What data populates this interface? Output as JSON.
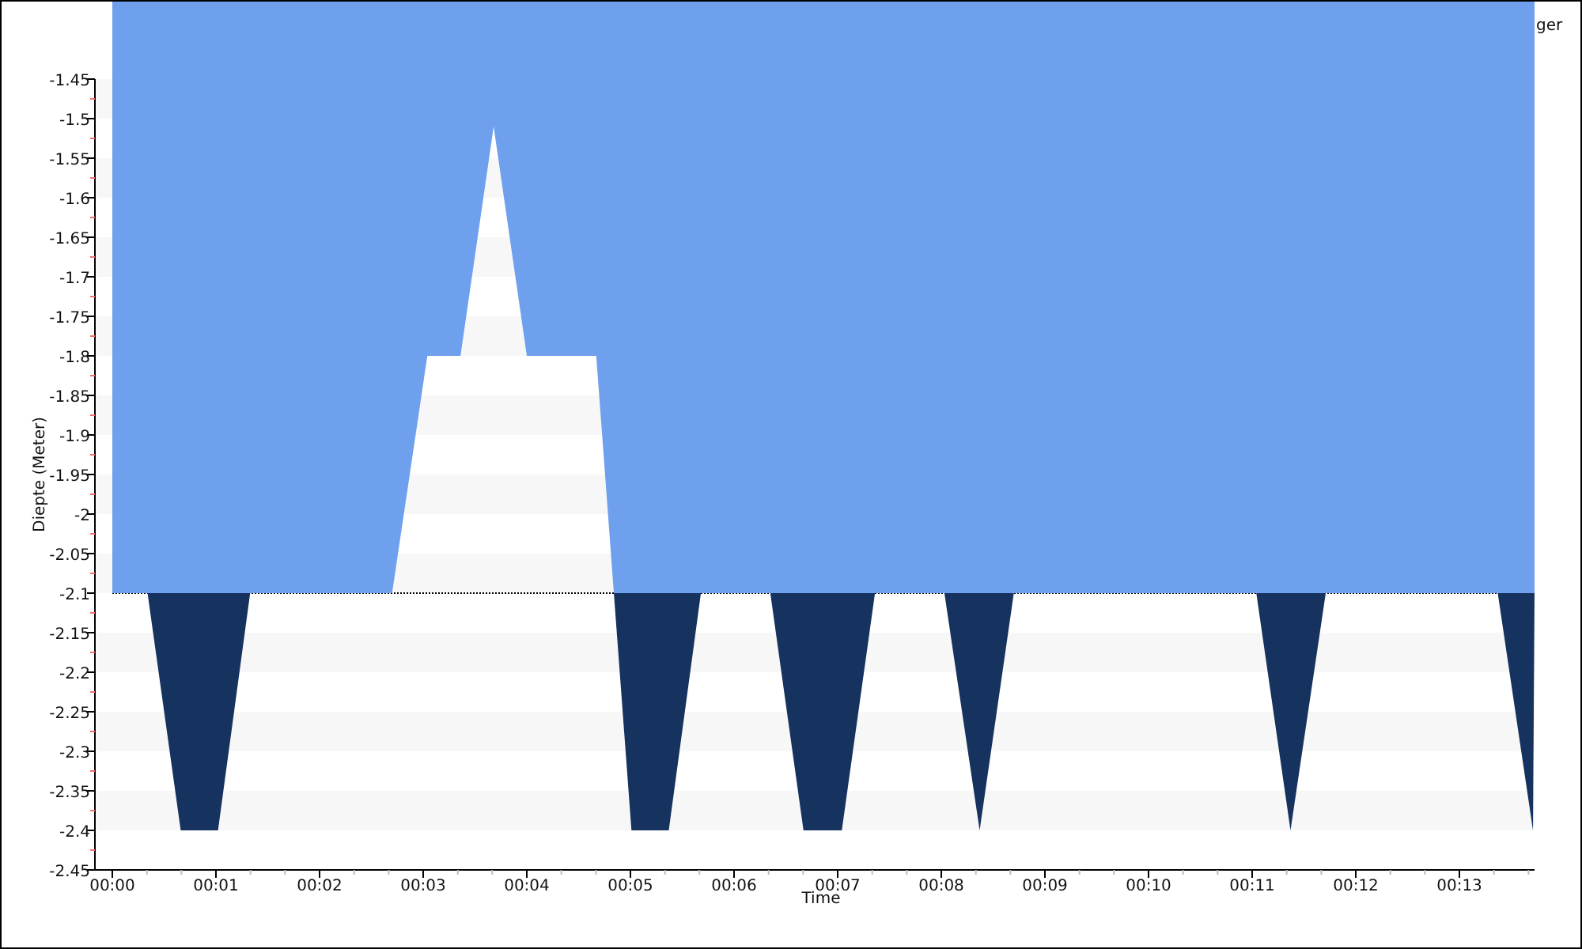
{
  "chart_data": {
    "type": "area",
    "xlabel": "Time",
    "ylabel": "Diepte (Meter)",
    "xlim": [
      -0.168,
      13.725
    ],
    "ylim": [
      -2.45,
      -1.45
    ],
    "xticks": [
      {
        "value": 0,
        "label": "00:00"
      },
      {
        "value": 1,
        "label": "00:01"
      },
      {
        "value": 2,
        "label": "00:02"
      },
      {
        "value": 3,
        "label": "00:03"
      },
      {
        "value": 4,
        "label": "00:04"
      },
      {
        "value": 5,
        "label": "00:05"
      },
      {
        "value": 6,
        "label": "00:06"
      },
      {
        "value": 7,
        "label": "00:07"
      },
      {
        "value": 8,
        "label": "00:08"
      },
      {
        "value": 9,
        "label": "00:09"
      },
      {
        "value": 10,
        "label": "00:10"
      },
      {
        "value": 11,
        "label": "00:11"
      },
      {
        "value": 12,
        "label": "00:12"
      },
      {
        "value": 13,
        "label": "00:13"
      }
    ],
    "yticks": [
      -2.45,
      -2.4,
      -2.35,
      -2.3,
      -2.25,
      -2.2,
      -2.15,
      -2.1,
      -2.05,
      -2,
      -1.95,
      -1.9,
      -1.85,
      -1.8,
      -1.75,
      -1.7,
      -1.65,
      -1.6,
      -1.55,
      -1.5,
      -1.45
    ],
    "x": [
      0,
      0.34,
      0.66,
      1.02,
      1.33,
      2.7,
      3.04,
      3.36,
      3.68,
      4.0,
      4.67,
      4.84,
      5.01,
      5.37,
      5.68,
      6.35,
      6.67,
      7.04,
      7.36,
      8.03,
      8.37,
      8.7,
      11.04,
      11.37,
      11.71,
      13.37,
      13.71,
      13.725
    ],
    "series": [
      {
        "name": "ger",
        "color": "#6fa0ee",
        "values": [
          -2.1,
          -2.1,
          -2.1,
          -2.1,
          -2.1,
          -2.1,
          -1.8,
          -1.8,
          -1.51,
          -1.8,
          -1.8,
          -2.1,
          -2.1,
          -2.1,
          -2.1,
          -2.1,
          -2.1,
          -2.1,
          -2.1,
          -2.1,
          -2.1,
          -2.1,
          -2.1,
          -2.1,
          -2.1,
          -2.1,
          -2.1,
          -2.1
        ]
      },
      {
        "color": "#16325f",
        "values": [
          -2.1,
          -2.1,
          -2.4,
          -2.4,
          -2.1,
          -2.1,
          -2.1,
          -2.1,
          -2.1,
          -2.1,
          -2.1,
          -2.1,
          -2.4,
          -2.4,
          -2.1,
          -2.1,
          -2.4,
          -2.4,
          -2.1,
          -2.1,
          -2.4,
          -2.1,
          -2.1,
          -2.4,
          -2.1,
          -2.1,
          -2.4,
          -2.1
        ]
      }
    ]
  }
}
